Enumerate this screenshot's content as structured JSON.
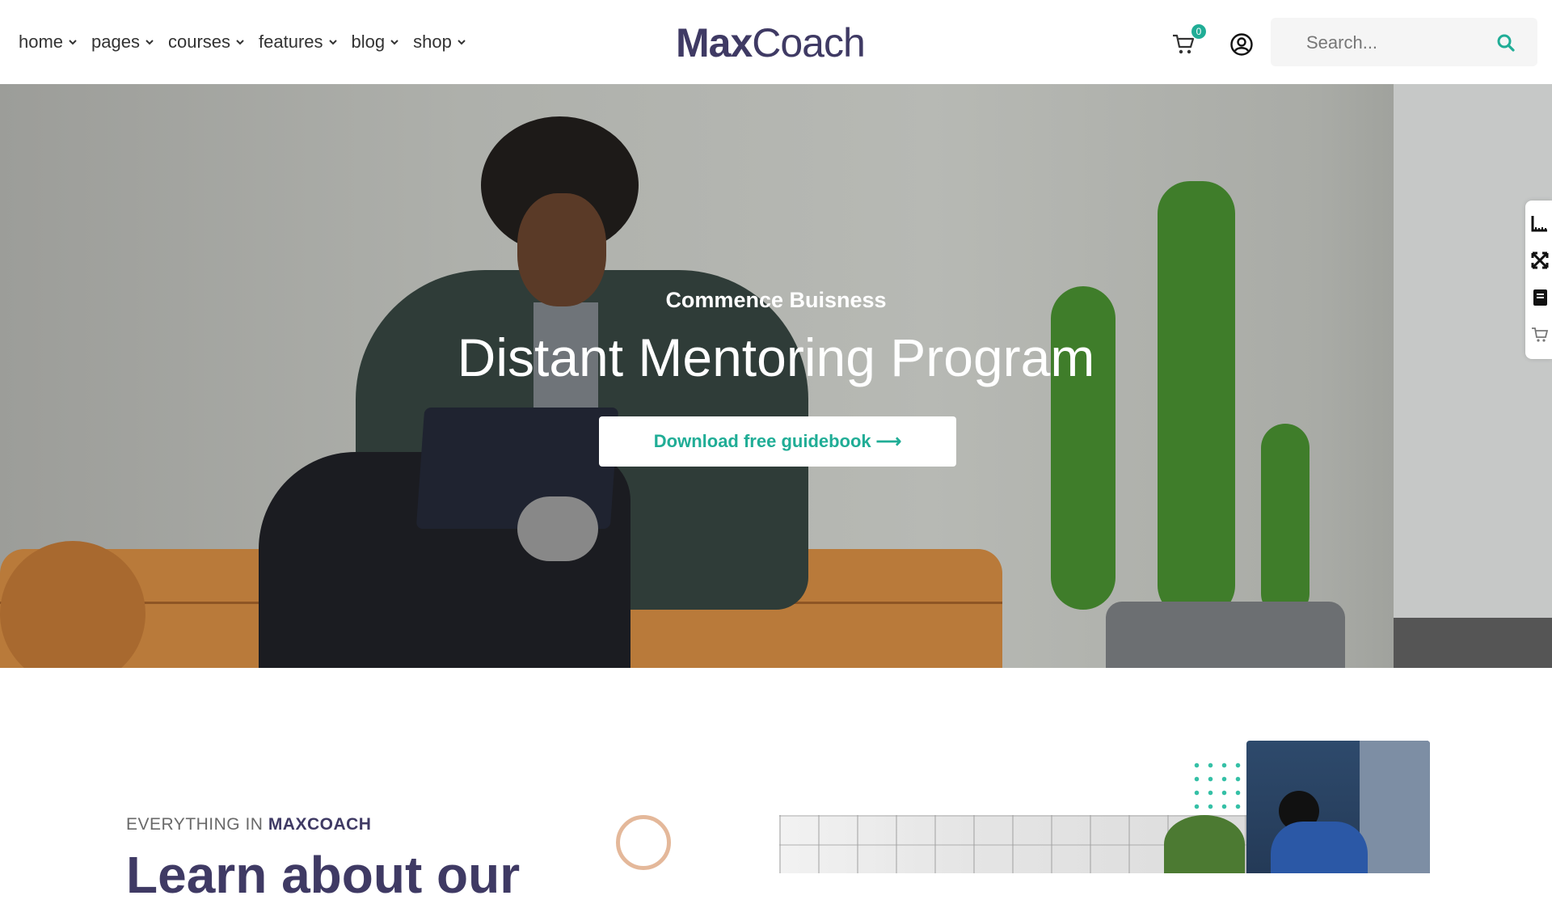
{
  "header": {
    "nav": [
      {
        "label": "home"
      },
      {
        "label": "pages"
      },
      {
        "label": "courses"
      },
      {
        "label": "features"
      },
      {
        "label": "blog"
      },
      {
        "label": "shop"
      }
    ],
    "logo": {
      "part1": "Max",
      "part2": "Coach"
    },
    "cart_count": "0",
    "search_placeholder": "Search..."
  },
  "hero": {
    "subtitle": "Commence Buisness",
    "title": "Distant Mentoring Program",
    "button_label": "Download free guidebook",
    "button_arrow": "⟶"
  },
  "side_toolbar": {
    "icons": [
      "ruler-icon",
      "fullscreen-icon",
      "book-icon",
      "cart-icon"
    ]
  },
  "about": {
    "eyebrow_prefix": "EVERYTHING IN ",
    "eyebrow_brand": "MAXCOACH",
    "heading": "Learn about our"
  },
  "colors": {
    "accent": "#20ad96",
    "brand": "#3f3a64",
    "deco_circle": "#e4b89a"
  }
}
